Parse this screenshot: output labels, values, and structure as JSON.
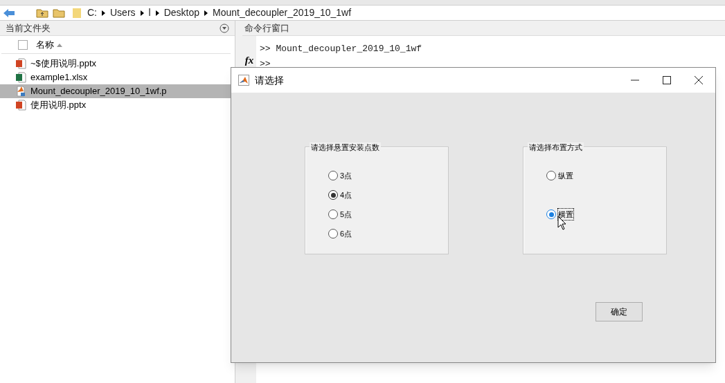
{
  "address_bar": {
    "path": [
      "C:",
      "Users",
      "l",
      "Desktop",
      "Mount_decoupler_2019_10_1wf"
    ]
  },
  "current_folder": {
    "title": "当前文件夹",
    "column": "名称",
    "select_all_checked": false,
    "files": [
      {
        "name": "~$使用说明.pptx",
        "kind": "powerpoint",
        "selected": false
      },
      {
        "name": "example1.xlsx",
        "kind": "excel",
        "selected": false
      },
      {
        "name": "Mount_decoupler_2019_10_1wf.p",
        "kind": "matlab",
        "selected": true
      },
      {
        "name": "使用说明.pptx",
        "kind": "powerpoint",
        "selected": false
      }
    ]
  },
  "command_window": {
    "title": "命令行窗口",
    "function_button": "fx",
    "lines": [
      ">> Mount_decoupler_2019_10_1wf"
    ],
    "prompt": ">>"
  },
  "dialog": {
    "title": "请选择",
    "groups": [
      {
        "title": "请选择悬置安装点数",
        "options": [
          {
            "label": "3点",
            "selected": false
          },
          {
            "label": "4点",
            "selected": true
          },
          {
            "label": "5点",
            "selected": false
          },
          {
            "label": "6点",
            "selected": false
          }
        ]
      },
      {
        "title": "请选择布置方式",
        "options": [
          {
            "label": "纵置",
            "selected": false
          },
          {
            "label": "横置",
            "selected": true
          }
        ]
      }
    ],
    "button": "确定"
  }
}
